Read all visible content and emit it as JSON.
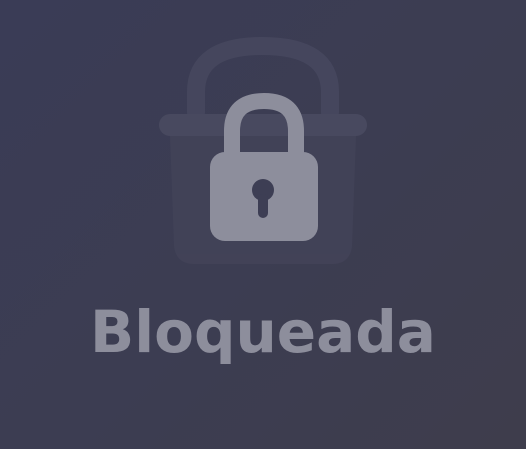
{
  "screen": {
    "status_label": "Bloqueada",
    "background_icon": "basket-icon",
    "main_icon": "padlock-icon",
    "keyhole_icon": "keyhole-icon"
  },
  "colors": {
    "background": "#3b3c53",
    "padlock": "#8d8e9c",
    "basket": "#45465c",
    "label": "#8d8e9c"
  }
}
